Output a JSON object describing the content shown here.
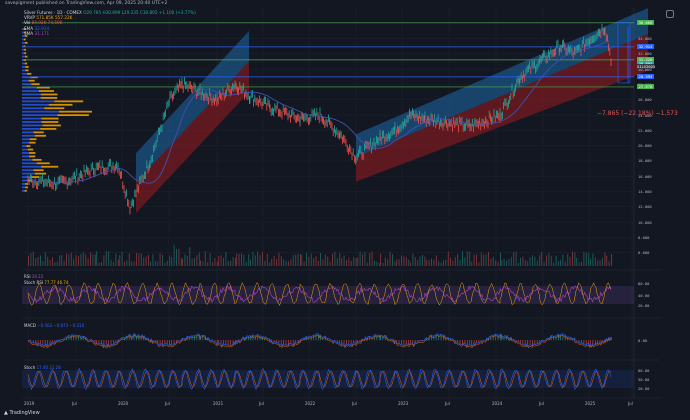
{
  "header": {
    "published_by": "savepigment published on TradingView.com, Apr 09, 2025 20:40 UTC+2"
  },
  "legend": {
    "symbol": "Silver Futures · 1D · COMEX",
    "ohlc": "O29.785 H30.899 L29.235 C30.805 +1.100 (+3.77%)",
    "vrvp_label": "VRVP",
    "vrvp_values": "571.85K 557.22K",
    "vol_label": "Vol",
    "vol_values": "84.92K 74.59K",
    "sma1_label": "SMA",
    "sma1_value": "32.914",
    "sma2_label": "SMA",
    "sma2_value": "31.171"
  },
  "colors": {
    "bg": "#131722",
    "grid": "#1e222d",
    "up": "#26a69a",
    "down": "#ef5350",
    "blue_channel": "#2196f3",
    "red_channel": "#b71c1c",
    "sma": "#3f51b5",
    "vrvp_orange": "#f7a600",
    "vrvp_blue": "#2962ff",
    "green_line": "#4caf50"
  },
  "price_axis": {
    "unit": "USD",
    "ticks": [
      "36.000",
      "34.000",
      "32.000",
      "30.000",
      "28.000",
      "26.000",
      "24.000",
      "22.000",
      "20.000",
      "18.000",
      "16.000",
      "14.000",
      "12.000",
      "10.000",
      "8.000",
      "6.000"
    ],
    "min": 4,
    "max": 38
  },
  "price_tags": [
    {
      "label": "36.060",
      "value": 36.06,
      "color": "#4caf50"
    },
    {
      "label": "32.914",
      "value": 32.914,
      "color": "#2962ff"
    },
    {
      "label": "31.220",
      "value": 31.22,
      "color": "#4caf50"
    },
    {
      "label": "30.805",
      "value": 30.805,
      "color": "#26a69a"
    },
    {
      "label": "SILV2025",
      "value": 30.3,
      "color": "#363a45"
    },
    {
      "label": "28.995",
      "value": 28.995,
      "color": "#2962ff"
    },
    {
      "label": "27.678",
      "value": 27.678,
      "color": "#4caf50"
    }
  ],
  "measure_label": "−7.865 (−22.18%) −1,573",
  "time_axis": [
    "2019",
    "Jul",
    "2020",
    "Jul",
    "2021",
    "Jul",
    "2022",
    "Jul",
    "2023",
    "Jul",
    "2024",
    "Jul",
    "2025",
    "Jul"
  ],
  "indicators": {
    "rsi": {
      "label": "RSI",
      "values": "39.22",
      "sub_label": "Stoch RSI",
      "sub_values": "77.77 46.74",
      "ticks": [
        "80.00",
        "40.00",
        "20.00"
      ]
    },
    "macd": {
      "label": "MACD",
      "values": "−0.563 −0.873 −0.310",
      "ticks": [
        "0.00"
      ]
    },
    "stoch": {
      "label": "Stoch",
      "values": "17.40 31.28",
      "ticks": [
        "80.00",
        "50.00",
        "20.00"
      ]
    }
  },
  "footer": {
    "logo_text": "TradingView"
  }
}
